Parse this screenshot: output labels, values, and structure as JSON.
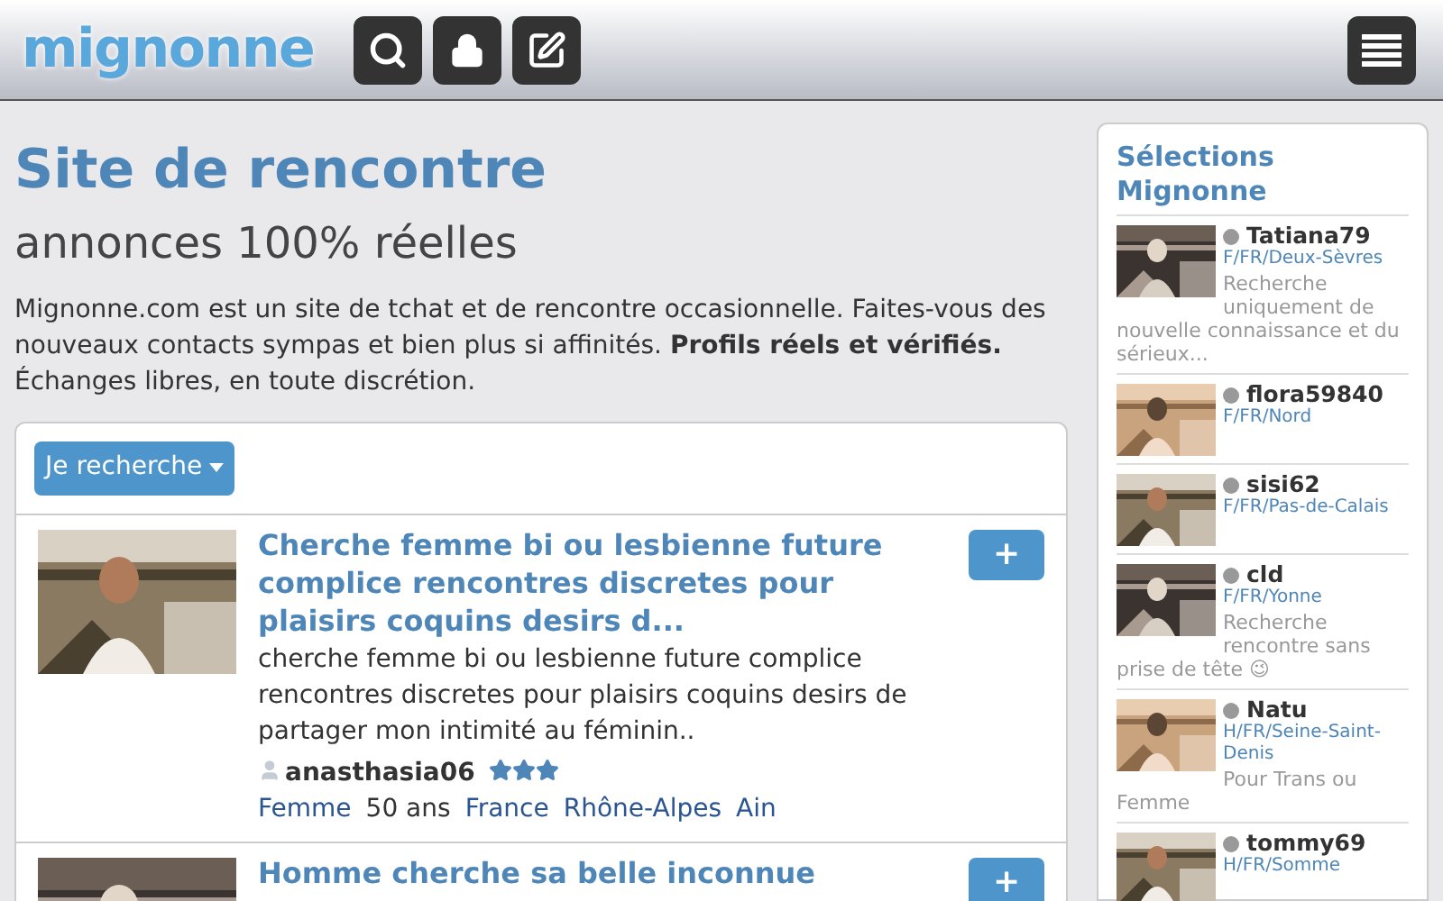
{
  "header": {
    "logo": "mignonne"
  },
  "intro": {
    "title": "Site de rencontre",
    "subtitle": "annonces 100% réelles",
    "text": "Mignonne.com est un site de tchat et de rencontre occasionnelle. Faites-vous des nouveaux contacts sympas et bien plus si affinités. **Profils réels et vérifiés.** Échanges libres, en toute discrétion."
  },
  "search_button": "Je recherche",
  "listings": [
    {
      "title": "Cherche femme bi ou lesbienne future complice rencontres discretes pour plaisirs coquins desirs d...",
      "text": "cherche femme bi ou lesbienne future complice rencontres discretes pour plaisirs coquins desirs de partager mon intimité au féminin..",
      "user": "anasthasia06",
      "stars": 3,
      "gender": "Femme",
      "age": "50 ans",
      "country": "France",
      "region": "Rhône-Alpes",
      "department": "Ain",
      "add": "+"
    },
    {
      "title": "Homme cherche sa belle inconnue",
      "add": "+"
    }
  ],
  "sidebar": {
    "title": "Sélections Mignonne",
    "profiles": [
      {
        "name": "Tatiana79",
        "location": "F/FR/Deux-Sèvres",
        "text": "Recherche uniquement de nouvelle connaissance et du sérieux..."
      },
      {
        "name": "flora59840",
        "location": "F/FR/Nord"
      },
      {
        "name": "sisi62",
        "location": "F/FR/Pas-de-Calais"
      },
      {
        "name": "cld",
        "location": "F/FR/Yonne",
        "text": "Recherche rencontre sans prise de tête 😉"
      },
      {
        "name": "Natu",
        "location": "H/FR/Seine-Saint-Denis",
        "text": "Pour Trans ou Femme"
      },
      {
        "name": "tommy69",
        "location": "H/FR/Somme"
      }
    ]
  }
}
